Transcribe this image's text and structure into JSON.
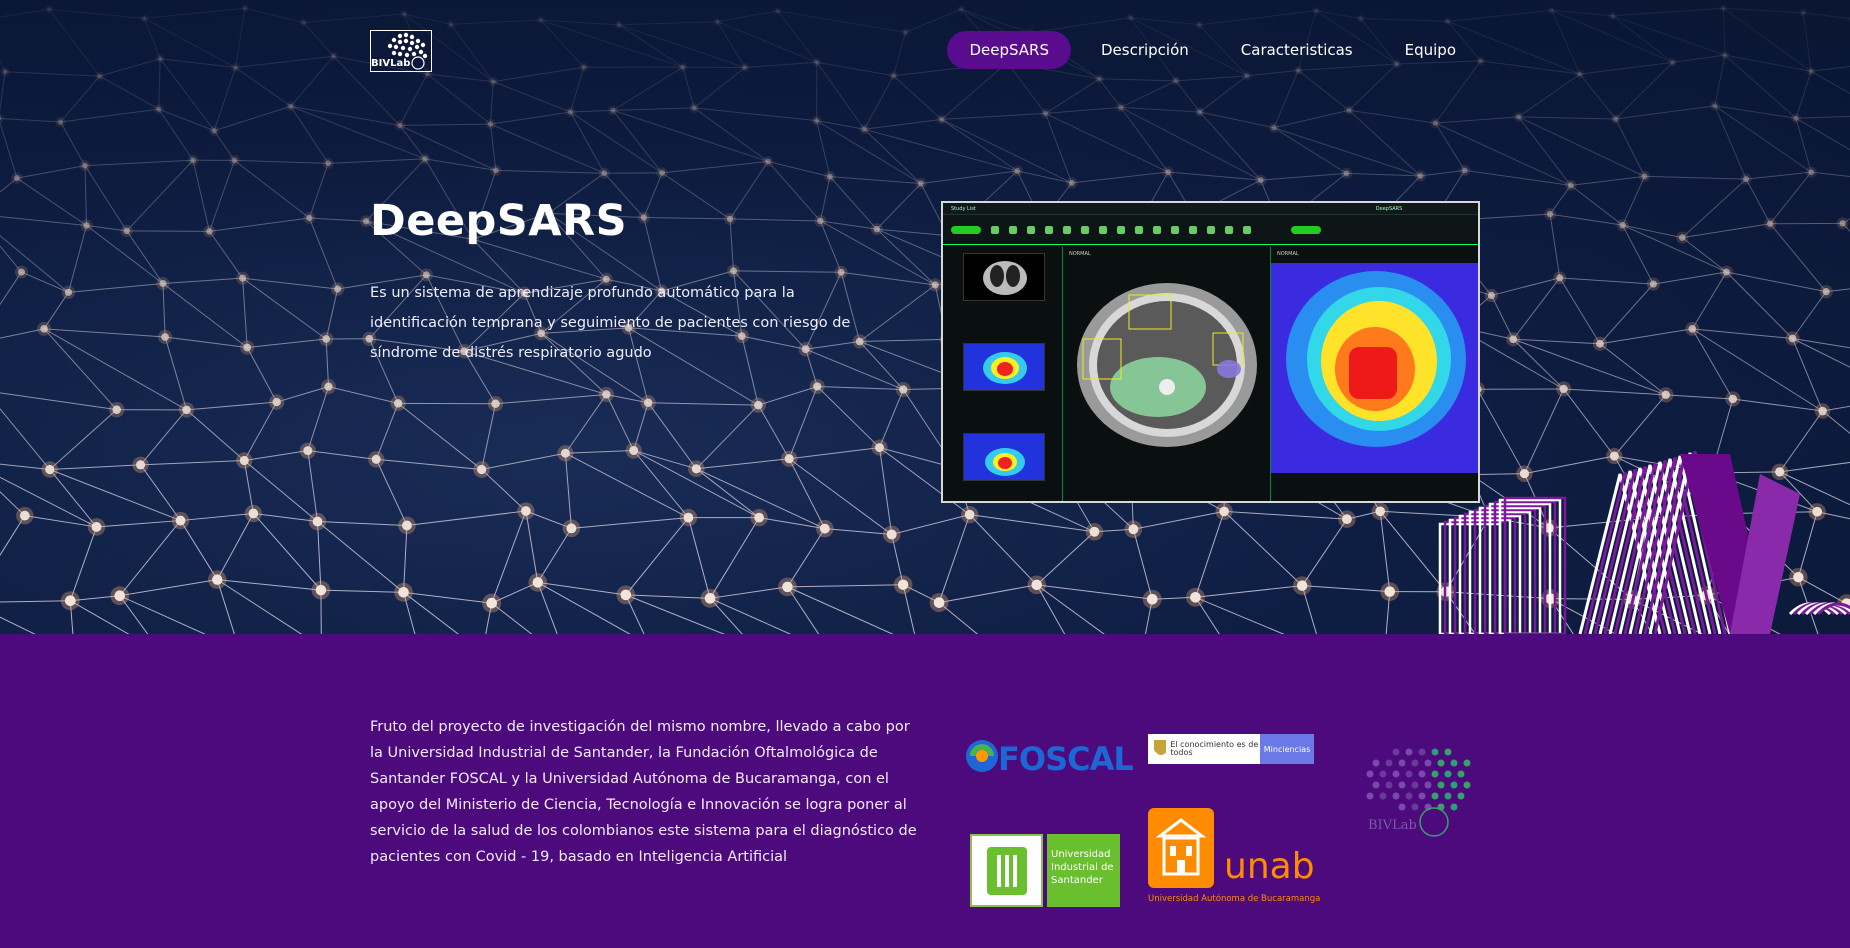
{
  "brand": {
    "logo_text": "BIVLab"
  },
  "nav": {
    "items": [
      {
        "label": "DeepSARS",
        "active": true
      },
      {
        "label": "Descripción",
        "active": false
      },
      {
        "label": "Caracteristicas",
        "active": false
      },
      {
        "label": "Equipo",
        "active": false
      }
    ]
  },
  "hero": {
    "title": "DeepSARS",
    "description": "Es un sistema de aprendizaje profundo automático para la identificación temprana y seguimiento de pacientes con riesgo de síndrome de distrés respiratorio agudo"
  },
  "app_preview": {
    "header_left": "Study List",
    "header_right": "DeepSARS",
    "view_left_label": "NORMAL",
    "view_right_label": "NORMAL"
  },
  "about": {
    "text": "Fruto del proyecto de investigación del mismo nombre, llevado a cabo por la Universidad Industrial de Santander, la Fundación Oftalmológica de Santander FOSCAL y la Universidad Autónoma de Bucaramanga, con el apoyo del Ministerio de Ciencia, Tecnología e Innovación se logra poner al servicio de la salud de los colombianos este sistema para el diagnóstico de pacientes con Covid - 19, basado en Inteligencia Artificial"
  },
  "partners": {
    "foscal": "FOSCAL",
    "minciencias_left": "El conocimiento es de todos",
    "minciencias_right": "Minciencias",
    "uis_text": "Universidad Industrial de Santander",
    "unab_word": "unab",
    "unab_sub": "Universidad Autónoma de Bucaramanga",
    "bivlab": "BIVLab"
  },
  "colors": {
    "purple_bg": "#4c0a7c",
    "nav_active": "#5a0c8f",
    "hero_bg": "#0f1f45",
    "foscal_blue": "#1d66d6",
    "uis_green": "#6abf2e",
    "unab_orange": "#ff8c00",
    "minciencias_blue": "#6b79e6"
  }
}
